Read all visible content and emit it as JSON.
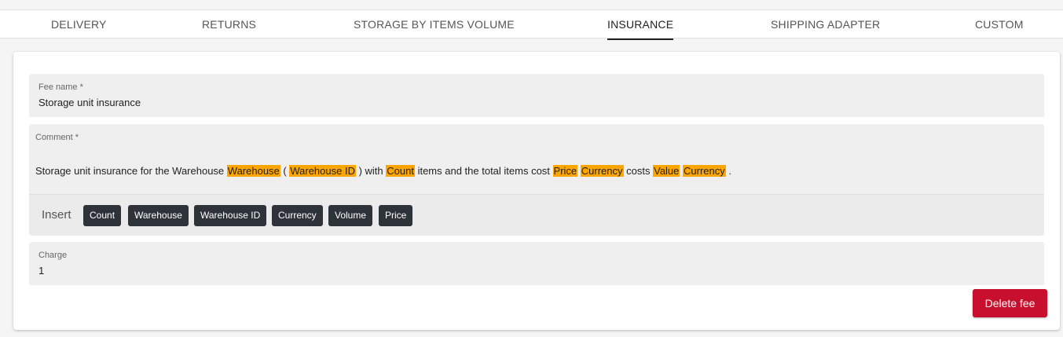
{
  "tabs": [
    {
      "label": "DELIVERY"
    },
    {
      "label": "RETURNS"
    },
    {
      "label": "STORAGE BY ITEMS VOLUME"
    },
    {
      "label": "INSURANCE"
    },
    {
      "label": "SHIPPING ADAPTER"
    },
    {
      "label": "CUSTOM"
    }
  ],
  "active_tab": "INSURANCE",
  "fee_name": {
    "label": "Fee name *",
    "value": "Storage unit insurance"
  },
  "comment": {
    "label": "Comment *",
    "segments": [
      {
        "text": "Storage unit insurance for the Warehouse ",
        "token": false
      },
      {
        "text": "Warehouse",
        "token": true
      },
      {
        "text": " ( ",
        "token": false
      },
      {
        "text": "Warehouse ID",
        "token": true
      },
      {
        "text": " ) with ",
        "token": false
      },
      {
        "text": "Count",
        "token": true
      },
      {
        "text": " items and the total items cost ",
        "token": false
      },
      {
        "text": "Price",
        "token": true
      },
      {
        "text": " ",
        "token": false
      },
      {
        "text": "Currency",
        "token": true
      },
      {
        "text": " costs ",
        "token": false
      },
      {
        "text": "Value",
        "token": true
      },
      {
        "text": " ",
        "token": false
      },
      {
        "text": "Currency",
        "token": true
      },
      {
        "text": " .",
        "token": false
      }
    ]
  },
  "insert": {
    "label": "Insert",
    "chips": [
      "Count",
      "Warehouse",
      "Warehouse ID",
      "Currency",
      "Volume",
      "Price"
    ]
  },
  "charge": {
    "label": "Charge",
    "value": "1"
  },
  "delete_label": "Delete fee",
  "colors": {
    "token_highlight": "#ffa500",
    "chip_bg": "#2e333a",
    "delete_bg": "#c8102e",
    "field_bg": "#efefef"
  }
}
